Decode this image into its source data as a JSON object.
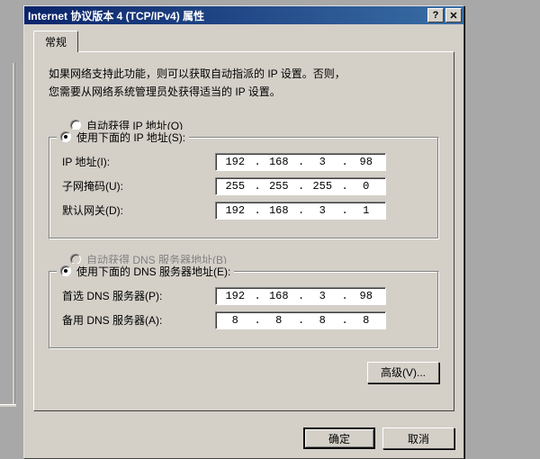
{
  "window": {
    "title": "Internet 协议版本 4 (TCP/IPv4) 属性",
    "help": "?",
    "close": "✕"
  },
  "tab": {
    "general": "常规"
  },
  "description": {
    "line1": "如果网络支持此功能，则可以获取自动指派的 IP 设置。否则，",
    "line2": "您需要从网络系统管理员处获得适当的 IP 设置。"
  },
  "ip": {
    "auto_label": "自动获得 IP 地址(O)",
    "manual_label": "使用下面的 IP 地址(S):",
    "addr_label": "IP 地址(I):",
    "mask_label": "子网掩码(U):",
    "gw_label": "默认网关(D):",
    "addr": {
      "o1": "192",
      "o2": "168",
      "o3": "3",
      "o4": "98"
    },
    "mask": {
      "o1": "255",
      "o2": "255",
      "o3": "255",
      "o4": "0"
    },
    "gw": {
      "o1": "192",
      "o2": "168",
      "o3": "3",
      "o4": "1"
    }
  },
  "dns": {
    "auto_label": "自动获得 DNS 服务器地址(B)",
    "manual_label": "使用下面的 DNS 服务器地址(E):",
    "pref_label": "首选 DNS 服务器(P):",
    "alt_label": "备用 DNS 服务器(A):",
    "pref": {
      "o1": "192",
      "o2": "168",
      "o3": "3",
      "o4": "98"
    },
    "alt": {
      "o1": "8",
      "o2": "8",
      "o3": "8",
      "o4": "8"
    }
  },
  "buttons": {
    "advanced": "高级(V)...",
    "ok": "确定",
    "cancel": "取消"
  }
}
